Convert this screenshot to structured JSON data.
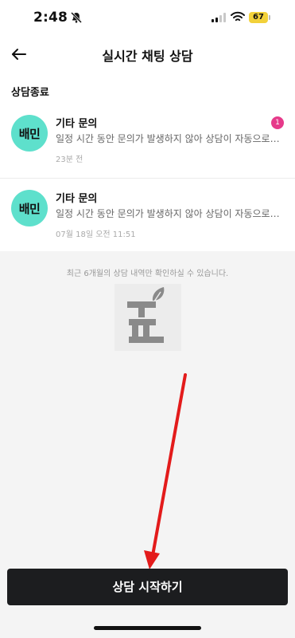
{
  "status_bar": {
    "time": "2:48",
    "battery": "67"
  },
  "header": {
    "title": "실시간 채팅 상담"
  },
  "section": {
    "title": "상담종료"
  },
  "chats": [
    {
      "avatar": "배민",
      "title": "기타 문의",
      "message": "일정 시간 동안 문의가 발생하지 않아 상담이 자동으로 종료되었습니다.",
      "time": "23분 전",
      "unread": "1"
    },
    {
      "avatar": "배민",
      "title": "기타 문의",
      "message": "일정 시간 동안 문의가 발생하지 않아 상담이 자동으로 종료되었습니다.",
      "time": "07월 18일 오전 11:51"
    }
  ],
  "history_note": "최근 6개월의 상담 내역만 확인하실 수 있습니다.",
  "start_button": "상담 시작하기",
  "colors": {
    "accent_mint": "#5ee0cc",
    "badge": "#e63a8a",
    "button": "#1c1d1f",
    "annotation_arrow": "#e31b1b"
  }
}
